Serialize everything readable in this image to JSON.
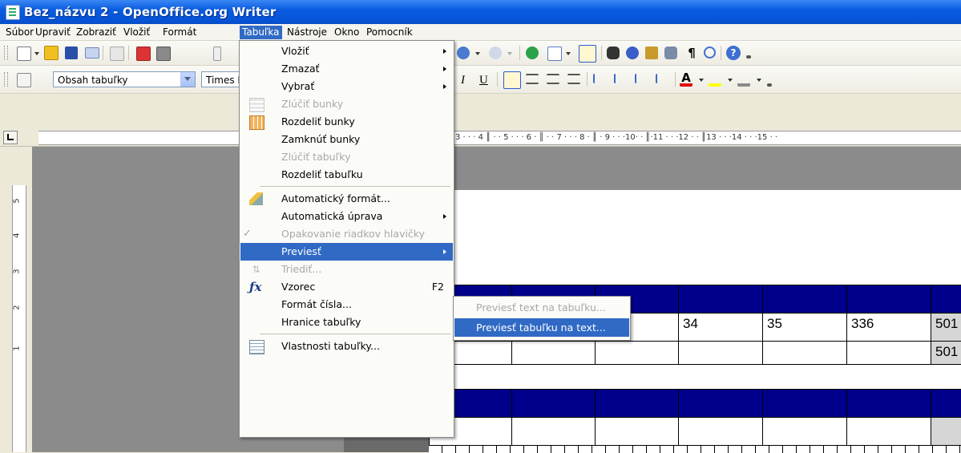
{
  "window": {
    "title": "Bez_názvu 2 - OpenOffice.org Writer"
  },
  "menubar": [
    {
      "label": "Súbor",
      "active": false
    },
    {
      "label": "Upraviť",
      "active": false
    },
    {
      "label": "Zobraziť",
      "active": false
    },
    {
      "label": "Vložiť",
      "active": false
    },
    {
      "label": "Formát",
      "active": false
    },
    {
      "label": "Tabuľka",
      "active": true
    },
    {
      "label": "Nástroje",
      "active": false
    },
    {
      "label": "Okno",
      "active": false
    },
    {
      "label": "Pomocník",
      "active": false
    }
  ],
  "formatting": {
    "style_value": "Obsah tabuľky",
    "font_value": "Times N",
    "italic": "I",
    "underline": "U"
  },
  "ruler": {
    "text": "3 · · · 4 ║ · · 5 · · · 6 · ║ · · 7 · · · 8 · ║ · 9 · · ·10· · ║·11 · · ·12 · · ║13 · · ·14 · · ·15 · ·"
  },
  "vruler_numbers": [
    "5",
    "4",
    "3",
    "2",
    "1"
  ],
  "table_menu": [
    {
      "label": "Vložiť",
      "submenu": true,
      "disabled": false
    },
    {
      "label": "Zmazať",
      "submenu": true,
      "disabled": false
    },
    {
      "label": "Vybrať",
      "submenu": true,
      "disabled": false
    },
    {
      "label": "Zlúčiť bunky",
      "disabled": true,
      "icon": "merge-cells-icon"
    },
    {
      "label": "Rozdeliť bunky",
      "disabled": false,
      "icon": "split-cells-icon"
    },
    {
      "label": "Zamknúť bunky",
      "disabled": false
    },
    {
      "label": "Zlúčiť tabuľky",
      "disabled": true
    },
    {
      "label": "Rozdeliť tabuľku",
      "disabled": false
    },
    {
      "label": "Automatický formát...",
      "disabled": false,
      "icon": "autoformat-icon"
    },
    {
      "label": "Automatická úprava",
      "submenu": true,
      "disabled": false
    },
    {
      "label": "Opakovanie riadkov hlavičky",
      "disabled": true,
      "icon": "checkmark-icon"
    },
    {
      "label": "Previesť",
      "submenu": true,
      "highlighted": true
    },
    {
      "label": "Triediť...",
      "disabled": true,
      "icon": "sort-icon"
    },
    {
      "label": "Vzorec",
      "shortcut": "F2",
      "icon": "formula-icon"
    },
    {
      "label": "Formát čísla...",
      "disabled": false
    },
    {
      "label": "Hranice tabuľky",
      "disabled": false
    },
    {
      "label": "Vlastnosti tabuľky...",
      "disabled": false,
      "icon": "table-properties-icon"
    }
  ],
  "convert_submenu": [
    {
      "label": "Previesť text na tabuľku...",
      "disabled": true
    },
    {
      "label": "Previesť tabuľku na text...",
      "highlighted": true
    }
  ],
  "table_cells": {
    "r1": [
      "34",
      "35",
      "336",
      "501"
    ],
    "r2": [
      "501"
    ]
  },
  "colors": {
    "highlight": "#316ac5",
    "table_header": "#00008a",
    "titlebar": "#0a5ce0"
  }
}
